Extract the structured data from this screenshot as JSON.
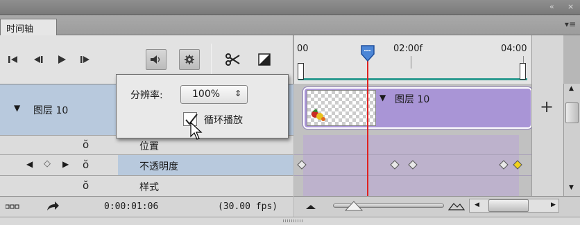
{
  "window": {
    "collapse_glyph": "«",
    "close_glyph": "×",
    "panel_menu_glyph": "▾≡"
  },
  "panel": {
    "tab_title": "时间轴"
  },
  "transport": {
    "first_frame": "first-frame-icon",
    "prev_frame": "previous-frame-icon",
    "play": "play-icon",
    "next_frame": "next-frame-icon",
    "audio": "speaker-icon",
    "settings": "gear-icon",
    "split": "scissors-icon",
    "transition": "transition-icon"
  },
  "ruler": {
    "label_start": "00",
    "label_mid": "02:00f",
    "label_end": "04:00"
  },
  "popup": {
    "resolution_label": "分辨率:",
    "resolution_value": "100%",
    "loop_label": "循环播放",
    "loop_checked": true
  },
  "layer": {
    "name": "图层 10",
    "clip_label": "图层 10",
    "menu_arrow": "▾"
  },
  "properties": [
    {
      "name": "位置"
    },
    {
      "name": "不透明度"
    },
    {
      "name": "样式"
    }
  ],
  "status": {
    "timecode": "0:00:01:06",
    "fps": "(30.00 fps)"
  },
  "add_track_glyph": "+",
  "colors": {
    "playhead": "#e0211f",
    "clip": "#a995d6",
    "selected_row": "#b8c9dd",
    "keyframe_active": "#f2d21b"
  }
}
